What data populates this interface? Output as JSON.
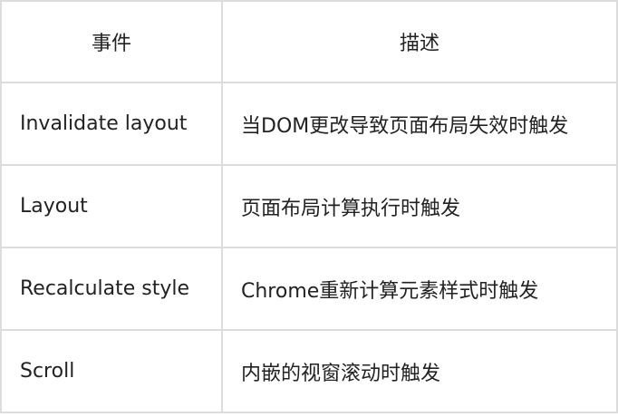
{
  "table": {
    "headers": [
      "事件",
      "描述"
    ],
    "rows": [
      {
        "event": "Invalidate layout",
        "description": "当DOM更改导致页面布局失效时触发"
      },
      {
        "event": "Layout",
        "description": "页面布局计算执行时触发"
      },
      {
        "event": "Recalculate style",
        "description": "Chrome重新计算元素样式时触发"
      },
      {
        "event": "Scroll",
        "description": "内嵌的视窗滚动时触发"
      }
    ]
  }
}
